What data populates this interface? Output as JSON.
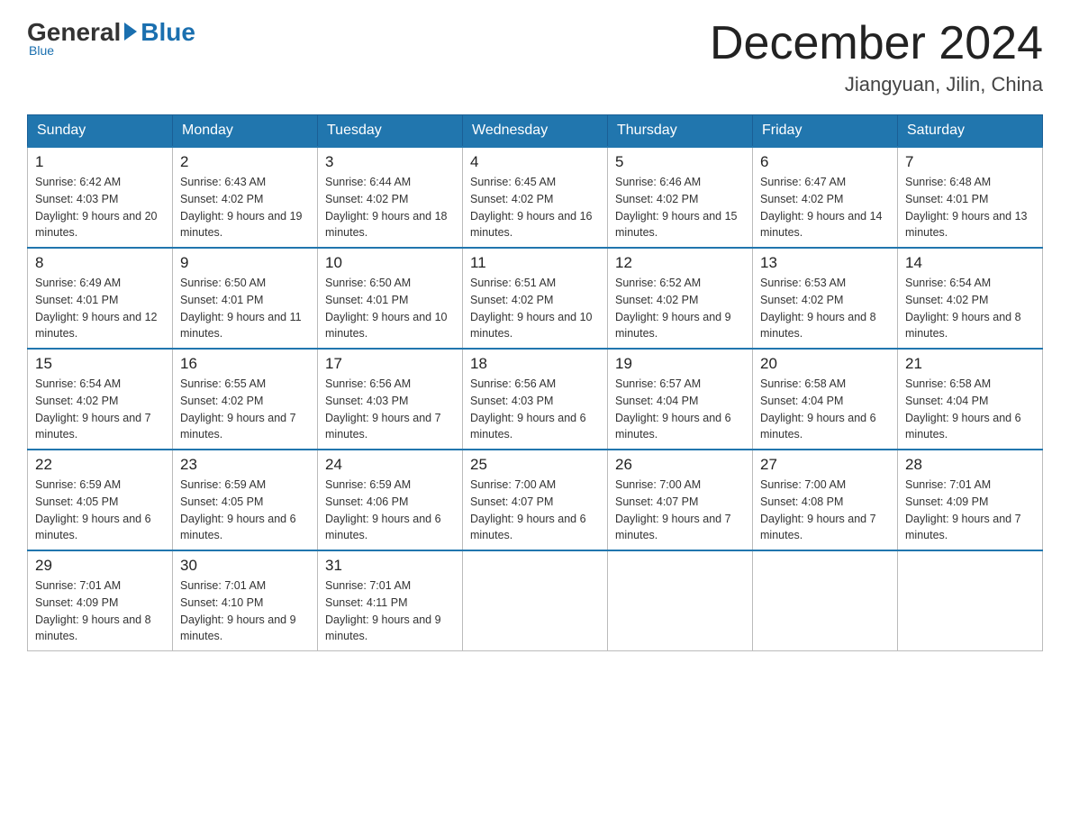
{
  "logo": {
    "general": "General",
    "blue": "Blue",
    "subtitle": "Blue"
  },
  "title": {
    "month": "December 2024",
    "location": "Jiangyuan, Jilin, China"
  },
  "days_of_week": [
    "Sunday",
    "Monday",
    "Tuesday",
    "Wednesday",
    "Thursday",
    "Friday",
    "Saturday"
  ],
  "weeks": [
    [
      {
        "day": "1",
        "sunrise": "6:42 AM",
        "sunset": "4:03 PM",
        "daylight": "9 hours and 20 minutes."
      },
      {
        "day": "2",
        "sunrise": "6:43 AM",
        "sunset": "4:02 PM",
        "daylight": "9 hours and 19 minutes."
      },
      {
        "day": "3",
        "sunrise": "6:44 AM",
        "sunset": "4:02 PM",
        "daylight": "9 hours and 18 minutes."
      },
      {
        "day": "4",
        "sunrise": "6:45 AM",
        "sunset": "4:02 PM",
        "daylight": "9 hours and 16 minutes."
      },
      {
        "day": "5",
        "sunrise": "6:46 AM",
        "sunset": "4:02 PM",
        "daylight": "9 hours and 15 minutes."
      },
      {
        "day": "6",
        "sunrise": "6:47 AM",
        "sunset": "4:02 PM",
        "daylight": "9 hours and 14 minutes."
      },
      {
        "day": "7",
        "sunrise": "6:48 AM",
        "sunset": "4:01 PM",
        "daylight": "9 hours and 13 minutes."
      }
    ],
    [
      {
        "day": "8",
        "sunrise": "6:49 AM",
        "sunset": "4:01 PM",
        "daylight": "9 hours and 12 minutes."
      },
      {
        "day": "9",
        "sunrise": "6:50 AM",
        "sunset": "4:01 PM",
        "daylight": "9 hours and 11 minutes."
      },
      {
        "day": "10",
        "sunrise": "6:50 AM",
        "sunset": "4:01 PM",
        "daylight": "9 hours and 10 minutes."
      },
      {
        "day": "11",
        "sunrise": "6:51 AM",
        "sunset": "4:02 PM",
        "daylight": "9 hours and 10 minutes."
      },
      {
        "day": "12",
        "sunrise": "6:52 AM",
        "sunset": "4:02 PM",
        "daylight": "9 hours and 9 minutes."
      },
      {
        "day": "13",
        "sunrise": "6:53 AM",
        "sunset": "4:02 PM",
        "daylight": "9 hours and 8 minutes."
      },
      {
        "day": "14",
        "sunrise": "6:54 AM",
        "sunset": "4:02 PM",
        "daylight": "9 hours and 8 minutes."
      }
    ],
    [
      {
        "day": "15",
        "sunrise": "6:54 AM",
        "sunset": "4:02 PM",
        "daylight": "9 hours and 7 minutes."
      },
      {
        "day": "16",
        "sunrise": "6:55 AM",
        "sunset": "4:02 PM",
        "daylight": "9 hours and 7 minutes."
      },
      {
        "day": "17",
        "sunrise": "6:56 AM",
        "sunset": "4:03 PM",
        "daylight": "9 hours and 7 minutes."
      },
      {
        "day": "18",
        "sunrise": "6:56 AM",
        "sunset": "4:03 PM",
        "daylight": "9 hours and 6 minutes."
      },
      {
        "day": "19",
        "sunrise": "6:57 AM",
        "sunset": "4:04 PM",
        "daylight": "9 hours and 6 minutes."
      },
      {
        "day": "20",
        "sunrise": "6:58 AM",
        "sunset": "4:04 PM",
        "daylight": "9 hours and 6 minutes."
      },
      {
        "day": "21",
        "sunrise": "6:58 AM",
        "sunset": "4:04 PM",
        "daylight": "9 hours and 6 minutes."
      }
    ],
    [
      {
        "day": "22",
        "sunrise": "6:59 AM",
        "sunset": "4:05 PM",
        "daylight": "9 hours and 6 minutes."
      },
      {
        "day": "23",
        "sunrise": "6:59 AM",
        "sunset": "4:05 PM",
        "daylight": "9 hours and 6 minutes."
      },
      {
        "day": "24",
        "sunrise": "6:59 AM",
        "sunset": "4:06 PM",
        "daylight": "9 hours and 6 minutes."
      },
      {
        "day": "25",
        "sunrise": "7:00 AM",
        "sunset": "4:07 PM",
        "daylight": "9 hours and 6 minutes."
      },
      {
        "day": "26",
        "sunrise": "7:00 AM",
        "sunset": "4:07 PM",
        "daylight": "9 hours and 7 minutes."
      },
      {
        "day": "27",
        "sunrise": "7:00 AM",
        "sunset": "4:08 PM",
        "daylight": "9 hours and 7 minutes."
      },
      {
        "day": "28",
        "sunrise": "7:01 AM",
        "sunset": "4:09 PM",
        "daylight": "9 hours and 7 minutes."
      }
    ],
    [
      {
        "day": "29",
        "sunrise": "7:01 AM",
        "sunset": "4:09 PM",
        "daylight": "9 hours and 8 minutes."
      },
      {
        "day": "30",
        "sunrise": "7:01 AM",
        "sunset": "4:10 PM",
        "daylight": "9 hours and 9 minutes."
      },
      {
        "day": "31",
        "sunrise": "7:01 AM",
        "sunset": "4:11 PM",
        "daylight": "9 hours and 9 minutes."
      },
      null,
      null,
      null,
      null
    ]
  ]
}
